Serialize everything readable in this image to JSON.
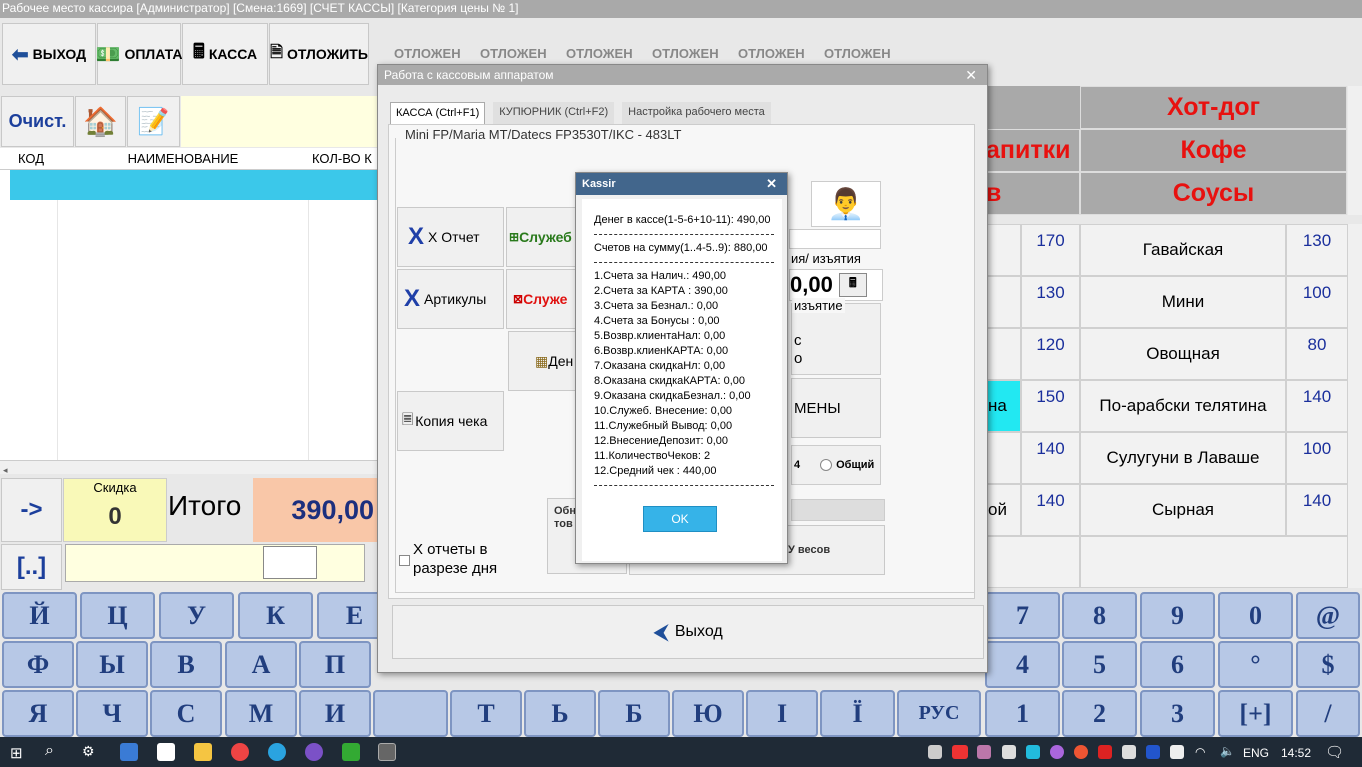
{
  "window": {
    "title": "Рабочее место кассира  [Администратор] [Смена:1669] [СЧЕТ КАССЫ] [Категория цены № 1]"
  },
  "toolbar": {
    "exit": "ВЫХОД",
    "pay": "ОПЛАТА",
    "cash": "КАССА",
    "postpone": "ОТЛОЖИТЬ"
  },
  "postponed": [
    "ОТЛОЖЕН",
    "ОТЛОЖЕН",
    "ОТЛОЖЕН",
    "ОТЛОЖЕН",
    "ОТЛОЖЕН",
    "ОТЛОЖЕН"
  ],
  "left": {
    "clear": "Очист.",
    "columns": [
      "КОД",
      "НАИМЕНОВАНИЕ",
      "КОЛ-ВО К"
    ],
    "arrow": "->",
    "dots": "[..]",
    "discount_label": "Скидка",
    "discount_value": "0",
    "total_label": "Итого",
    "total_value": "390,00"
  },
  "menu": {
    "categories": [
      "Хот-дог",
      "апитки",
      "Кофе",
      "в",
      "Соусы"
    ]
  },
  "products": [
    {
      "name": "Гавайская",
      "price": "130",
      "left_price": "170"
    },
    {
      "name": "Мини",
      "price": "100",
      "left_price": "130"
    },
    {
      "name": "Овощная",
      "price": "80",
      "left_price": "120"
    },
    {
      "name": "По-арабски телятина",
      "price": "140",
      "left_price": "150",
      "left_text": "на"
    },
    {
      "name": "Сулугуни в Лаваше",
      "price": "100",
      "left_price": "140"
    },
    {
      "name": "Сырная",
      "price": "140",
      "left_price": "140",
      "left_text": "ой"
    }
  ],
  "cash_dialog": {
    "title": "Работа с кассовым аппаратом",
    "tabs": [
      "КАССА (Ctrl+F1)",
      "КУПЮРНИК (Ctrl+F2)",
      "Настройка рабочего места"
    ],
    "device": "Mini FP/Maria MT/Datecs FP3530T/IKC - 483LT",
    "x_report": "X Отчет",
    "service1": "Служеб",
    "articles": "Артикулы",
    "service2": "Служе",
    "money": "Ден",
    "copy_check": "Копия чека",
    "in_out_label": "ия/ изъятия",
    "amount": "0,00",
    "withdraw": "изъятие",
    "withdraw_c": "с",
    "withdraw_o": "о",
    "shift": "МЕНЫ",
    "radio_4": "4",
    "radio_common": "Общий",
    "x_reports_day": "X отчеты в разрезе дня",
    "update_text": "Обн баз вес тов весах",
    "scales": "У весов",
    "exit": "Выход"
  },
  "kassir": {
    "title": "Kassir",
    "cash_in_register": "Денег в кассе(1-5-6+10-11): 490,00",
    "checks_sum": "Счетов на сумму(1..4-5..9): 880,00",
    "lines": [
      "1.Счета за  Налич.: 490,00",
      "2.Счета за  КАРТА : 390,00",
      "3.Счета за Безнал.: 0,00",
      "4.Счета за Бонусы : 0,00",
      "5.Возвр.клиентаНал: 0,00",
      "6.Возвр.клиенКАРТА: 0,00",
      "7.Оказана скидкаНл: 0,00",
      "8.Оказана скидкаКАРТА: 0,00",
      "9.Оказана скидкаБезнал.: 0,00",
      "10.Служеб. Внесение: 0,00",
      "11.Служебный  Вывод: 0,00",
      "12.ВнесениеДепозит: 0,00",
      "11.КоличествоЧеков: 2",
      "12.Средний  чек  : 440,00"
    ],
    "ok": "OK"
  },
  "keyboard": {
    "row1": [
      "Й",
      "Ц",
      "У",
      "К",
      "Е"
    ],
    "row1r": [
      "7",
      "8",
      "9",
      "0",
      "@"
    ],
    "row2": [
      "Ф",
      "Ы",
      "В",
      "А",
      "П"
    ],
    "row2r": [
      "4",
      "5",
      "6",
      "°",
      "$"
    ],
    "row3": [
      "Я",
      "Ч",
      "С",
      "М",
      "И",
      "",
      "Т",
      "Ь",
      "Б",
      "Ю",
      "І",
      "Ї",
      "РУС",
      "1",
      "2",
      "3",
      "[+]",
      "/"
    ]
  },
  "taskbar": {
    "lang": "ENG",
    "time": "14:52"
  }
}
